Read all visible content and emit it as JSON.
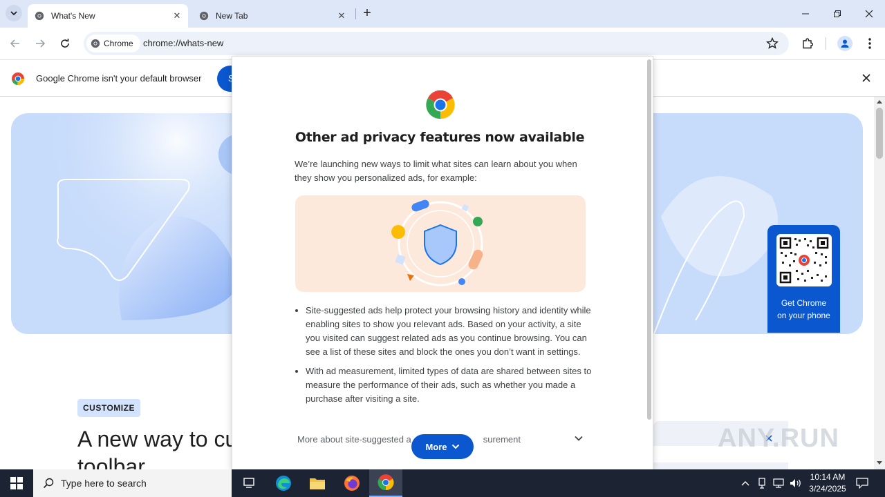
{
  "browser": {
    "tabs": [
      {
        "title": "What's New",
        "active": true
      },
      {
        "title": "New Tab",
        "active": false
      }
    ],
    "new_tab_symbol": "+",
    "omnibox": {
      "chip_label": "Chrome",
      "url": "chrome://whats-new"
    },
    "icons": {
      "back": "arrow-left-icon",
      "forward": "arrow-right-icon",
      "reload": "reload-icon",
      "bookmark": "star-icon",
      "extensions": "puzzle-icon",
      "profile": "profile-icon",
      "menu": "kebab-menu-icon"
    }
  },
  "infobar": {
    "message": "Google Chrome isn't your default browser",
    "button_label": "S"
  },
  "page": {
    "badge": "CUSTOMIZE",
    "headline_line1": "A new way to cu",
    "headline_line2": "toolbar",
    "qr_caption_line1": "Get Chrome",
    "qr_caption_line2": "on your phone"
  },
  "modal": {
    "title": "Other ad privacy features now available",
    "intro": "We’re launching new ways to limit what sites can learn about you when they show you personalized ads, for example:",
    "bullets": [
      "Site-suggested ads help protect your browsing history and identity while enabling sites to show you relevant ads. Based on your activity, a site you visited can suggest related ads as you continue browsing. You can see a list of these sites and block the ones you don’t want in settings.",
      "With ad measurement, limited types of data are shared between sites to measure the performance of their ads, such as whether you made a purchase after visiting a site."
    ],
    "more_about_left": "More about site-suggested a",
    "more_about_right": "surement",
    "more_button": "More"
  },
  "watermark": "ANY.RUN",
  "taskbar": {
    "search_placeholder": "Type here to search",
    "time": "10:14 AM",
    "date": "3/24/2025"
  },
  "colors": {
    "accent": "#0b57d0",
    "tabstrip": "#dee7f8",
    "hero": "#c7dbfb",
    "illustration": "#fde9dc",
    "taskbar": "#1c2433"
  }
}
